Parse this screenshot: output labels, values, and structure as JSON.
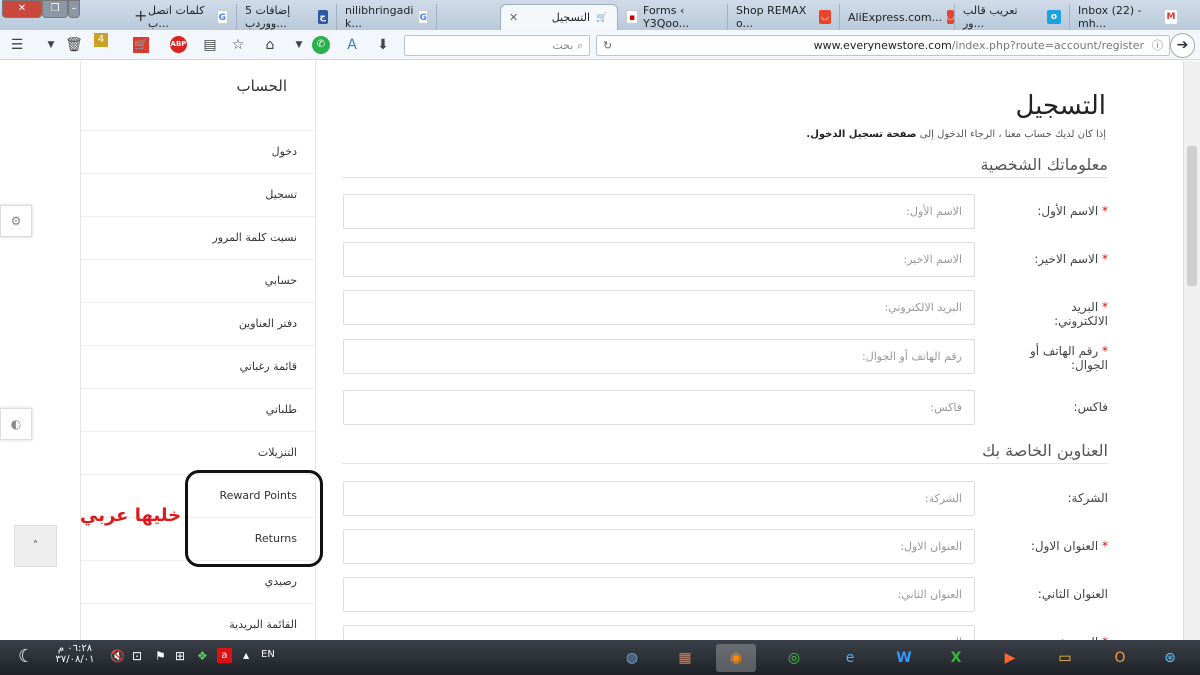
{
  "browser": {
    "tabs": [
      {
        "label": "كلمات اتصل ب...",
        "icon": "google-icon"
      },
      {
        "label": "5 إضافات ووردب...",
        "icon": "site-icon"
      },
      {
        "label": "nilibhringadi k...",
        "icon": "google-icon"
      },
      {
        "label": "التسجيل",
        "icon": "cart-icon",
        "active": true
      },
      {
        "label": "Forms ‹ Y3Qoo...",
        "icon": "site-icon"
      },
      {
        "label": "Shop REMAX o...",
        "icon": "aliexpress-icon"
      },
      {
        "label": "AliExpress.com...",
        "icon": "aliexpress-icon"
      },
      {
        "label": "تعريب قالب ور...",
        "icon": "site-icon"
      },
      {
        "label": "Inbox (22) - mh...",
        "icon": "gmail-icon"
      }
    ],
    "new_tab": "+",
    "search_placeholder": "بحث",
    "url_domain": "www.everynewstore.com",
    "url_path": "/index.php?route=account/register",
    "badge_count": "4",
    "abp_label": "ABP"
  },
  "sidebar": {
    "title": "الحساب",
    "items": [
      "دخول",
      "تسجيل",
      "نسيت كلمة المرور",
      "حسابي",
      "دفتر العناوين",
      "قائمة رغباتي",
      "طلباتي",
      "التنزيلات",
      "Reward Points",
      "Returns",
      "رصيدي",
      "القائمة البريدية"
    ]
  },
  "annotation": "خليها عربي",
  "main": {
    "title": "التسجيل",
    "intro": "إذا كان لديك حساب معنا ، الرجاء الدخول إلى",
    "intro_link": "صفحة تسجيل الدخول.",
    "section_personal": "معلوماتك الشخصية",
    "section_address": "العناوين الخاصة بك",
    "personal_fields": [
      {
        "label": "الاسم الأول:",
        "placeholder": "الاسم الأول:",
        "required": true
      },
      {
        "label": "الاسم الاخير:",
        "placeholder": "الاسم الاخير:",
        "required": true
      },
      {
        "label": "البريد الالكتروني:",
        "placeholder": "البريد الالكتروني:",
        "required": true
      },
      {
        "label": "رقم الهاتف أو الجوال:",
        "placeholder": "رقم الهاتف أو الجوال:",
        "required": true
      },
      {
        "label": "فاكس:",
        "placeholder": "فاكس:",
        "required": false
      }
    ],
    "address_fields": [
      {
        "label": "الشركة:",
        "placeholder": "الشركة:",
        "required": false
      },
      {
        "label": "العنوان الاول:",
        "placeholder": "العنوان الاول:",
        "required": true
      },
      {
        "label": "العنوان الثاني:",
        "placeholder": "العنوان الثاني:",
        "required": false
      },
      {
        "label": "المدينة:",
        "placeholder": "المدينة:",
        "required": true
      }
    ]
  },
  "taskbar": {
    "lang": "EN",
    "time": "٠٦:٢٨ م",
    "date": "٣٧/٠٨/٠١"
  }
}
